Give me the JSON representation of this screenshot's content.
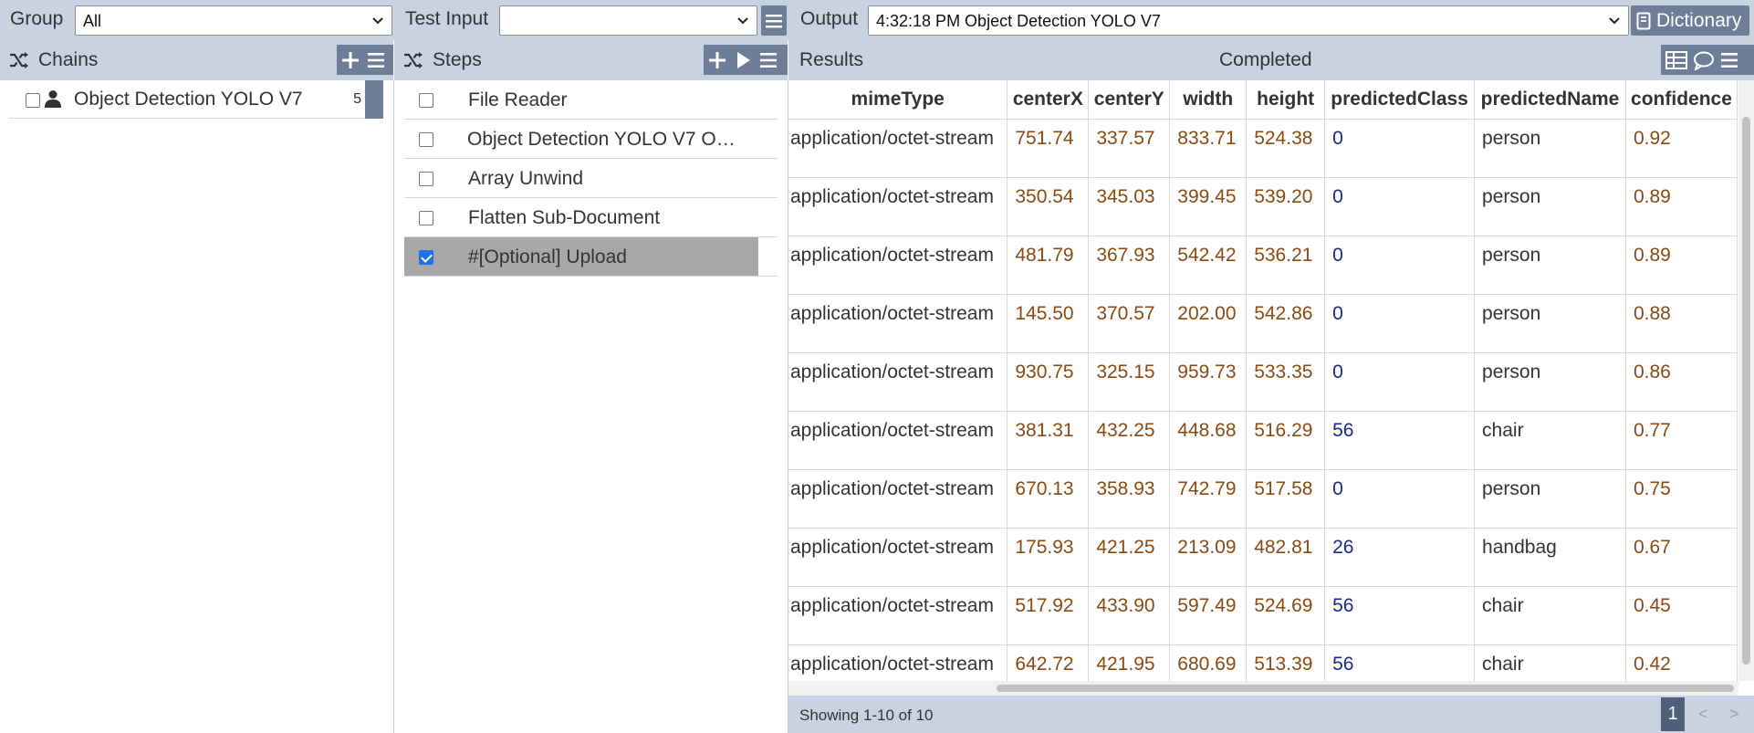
{
  "topbar": {
    "group_label": "Group",
    "group_value": "All",
    "test_input_label": "Test Input",
    "test_input_value": "",
    "output_label": "Output",
    "output_value": "4:32:18 PM Object Detection YOLO V7",
    "dictionary_label": "Dictionary"
  },
  "chains": {
    "title": "Chains",
    "items": [
      {
        "name": "Object Detection YOLO V7",
        "count": "5",
        "checked": false
      }
    ]
  },
  "steps": {
    "title": "Steps",
    "items": [
      {
        "name": "File Reader",
        "checked": false
      },
      {
        "name": "Object Detection YOLO V7 O…",
        "checked": false
      },
      {
        "name": "Array Unwind",
        "checked": false
      },
      {
        "name": "Flatten Sub-Document",
        "checked": false
      },
      {
        "name": "#[Optional] Upload",
        "checked": true
      }
    ]
  },
  "results": {
    "title": "Results",
    "status": "Completed",
    "columns": [
      "mimeType",
      "centerX",
      "centerY",
      "width",
      "height",
      "predictedClass",
      "predictedName",
      "confidence"
    ],
    "rows": [
      [
        "application/octet-stream",
        "751.74",
        "337.57",
        "833.71",
        "524.38",
        "0",
        "person",
        "0.92"
      ],
      [
        "application/octet-stream",
        "350.54",
        "345.03",
        "399.45",
        "539.20",
        "0",
        "person",
        "0.89"
      ],
      [
        "application/octet-stream",
        "481.79",
        "367.93",
        "542.42",
        "536.21",
        "0",
        "person",
        "0.89"
      ],
      [
        "application/octet-stream",
        "145.50",
        "370.57",
        "202.00",
        "542.86",
        "0",
        "person",
        "0.88"
      ],
      [
        "application/octet-stream",
        "930.75",
        "325.15",
        "959.73",
        "533.35",
        "0",
        "person",
        "0.86"
      ],
      [
        "application/octet-stream",
        "381.31",
        "432.25",
        "448.68",
        "516.29",
        "56",
        "chair",
        "0.77"
      ],
      [
        "application/octet-stream",
        "670.13",
        "358.93",
        "742.79",
        "517.58",
        "0",
        "person",
        "0.75"
      ],
      [
        "application/octet-stream",
        "175.93",
        "421.25",
        "213.09",
        "482.81",
        "26",
        "handbag",
        "0.67"
      ],
      [
        "application/octet-stream",
        "517.92",
        "433.90",
        "597.49",
        "524.69",
        "56",
        "chair",
        "0.45"
      ],
      [
        "application/octet-stream",
        "642.72",
        "421.95",
        "680.69",
        "513.39",
        "56",
        "chair",
        "0.42"
      ]
    ],
    "showing": "Showing 1-10 of 10",
    "current_page": "1",
    "prev_label": "<",
    "next_label": ">"
  },
  "icons": {
    "shuffle": "shuffle-icon",
    "user": "user-icon",
    "plus": "plus-icon",
    "menu": "menu-icon",
    "play": "play-icon",
    "table": "table-icon",
    "comment": "comment-icon",
    "book": "book-icon",
    "chevron": "chevron-down-icon"
  },
  "colors": {
    "panel": "#c9d2e0",
    "accent": "#6e7e99",
    "number": "#8a4a12",
    "class_id": "#1b2a8a",
    "selected_row": "#a8a8a8"
  }
}
